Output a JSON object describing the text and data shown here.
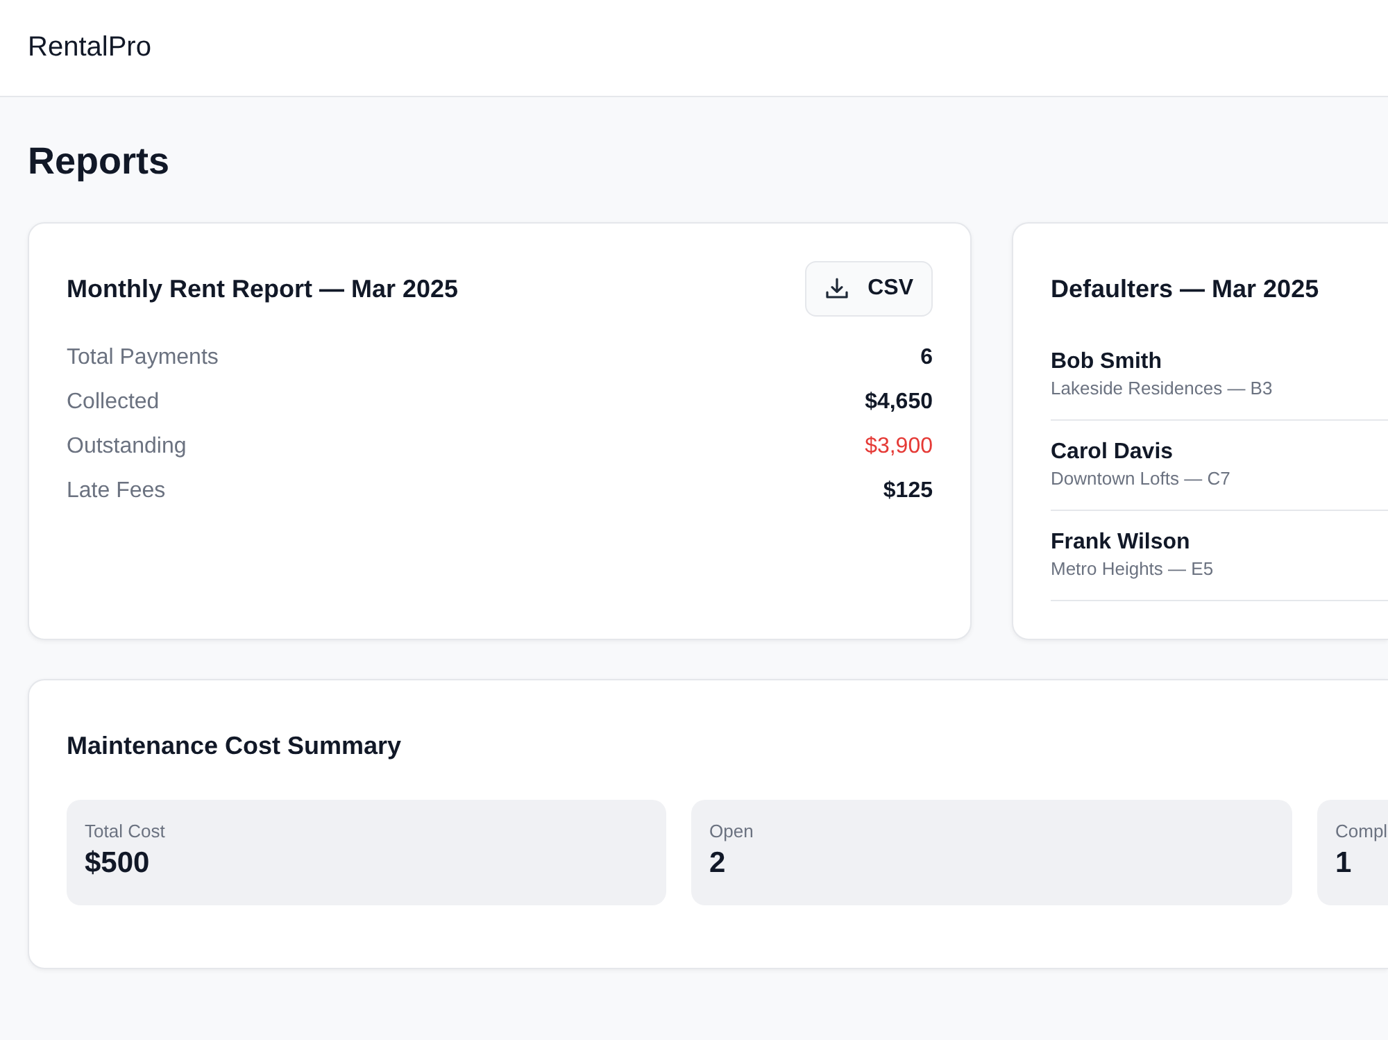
{
  "header": {
    "logo": "RentalPro"
  },
  "page": {
    "title": "Reports"
  },
  "rent_report": {
    "title": "Monthly Rent Report — Mar 2025",
    "export_button": "CSV",
    "rows": [
      {
        "label": "Total Payments",
        "value": "6",
        "kind": "plain"
      },
      {
        "label": "Collected",
        "value": "$4,650",
        "kind": "plain"
      },
      {
        "label": "Outstanding",
        "value": "$3,900",
        "kind": "alert"
      },
      {
        "label": "Late Fees",
        "value": "$125",
        "kind": "plain"
      }
    ]
  },
  "defaulters": {
    "title": "Defaulters — Mar 2025",
    "items": [
      {
        "name": "Bob Smith",
        "unit": "Lakeside Residences — B3"
      },
      {
        "name": "Carol Davis",
        "unit": "Downtown Lofts — C7"
      },
      {
        "name": "Frank Wilson",
        "unit": "Metro Heights — E5"
      }
    ]
  },
  "maintenance": {
    "title": "Maintenance Cost Summary",
    "stats": [
      {
        "label": "Total Cost",
        "value": "$500"
      },
      {
        "label": "Open",
        "value": "2"
      },
      {
        "label": "Compl",
        "value": "1"
      }
    ]
  }
}
